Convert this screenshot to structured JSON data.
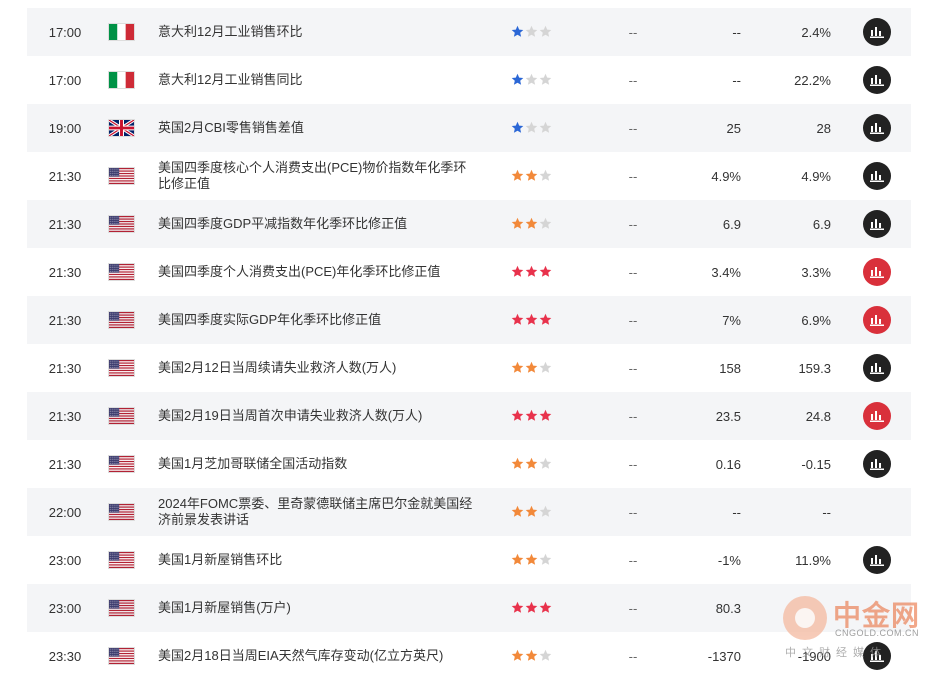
{
  "colors": {
    "star_blue": "#2b67d6",
    "star_orange": "#f2893a",
    "star_red": "#e8324c",
    "star_empty": "#d5d5d5",
    "btn_dark": "#222222",
    "btn_red": "#d9303b"
  },
  "rows": [
    {
      "time": "17:00",
      "flag": "italy",
      "title": "意大利12月工业销售环比",
      "stars": 1,
      "star_color": "blue",
      "prev": "--",
      "forecast": "--",
      "actual": "2.4%",
      "btn": "dark"
    },
    {
      "time": "17:00",
      "flag": "italy",
      "title": "意大利12月工业销售同比",
      "stars": 1,
      "star_color": "blue",
      "prev": "--",
      "forecast": "--",
      "actual": "22.2%",
      "btn": "dark"
    },
    {
      "time": "19:00",
      "flag": "uk",
      "title": "英国2月CBI零售销售差值",
      "stars": 1,
      "star_color": "blue",
      "prev": "--",
      "forecast": "25",
      "actual": "28",
      "btn": "dark"
    },
    {
      "time": "21:30",
      "flag": "us",
      "title": "美国四季度核心个人消费支出(PCE)物价指数年化季环比修正值",
      "stars": 2,
      "star_color": "orange",
      "prev": "--",
      "forecast": "4.9%",
      "actual": "4.9%",
      "btn": "dark"
    },
    {
      "time": "21:30",
      "flag": "us",
      "title": "美国四季度GDP平减指数年化季环比修正值",
      "stars": 2,
      "star_color": "orange",
      "prev": "--",
      "forecast": "6.9",
      "actual": "6.9",
      "btn": "dark"
    },
    {
      "time": "21:30",
      "flag": "us",
      "title": "美国四季度个人消费支出(PCE)年化季环比修正值",
      "stars": 3,
      "star_color": "red",
      "prev": "--",
      "forecast": "3.4%",
      "actual": "3.3%",
      "btn": "red"
    },
    {
      "time": "21:30",
      "flag": "us",
      "title": "美国四季度实际GDP年化季环比修正值",
      "stars": 3,
      "star_color": "red",
      "prev": "--",
      "forecast": "7%",
      "actual": "6.9%",
      "btn": "red"
    },
    {
      "time": "21:30",
      "flag": "us",
      "title": "美国2月12日当周续请失业救济人数(万人)",
      "stars": 2,
      "star_color": "orange",
      "prev": "--",
      "forecast": "158",
      "actual": "159.3",
      "btn": "dark"
    },
    {
      "time": "21:30",
      "flag": "us",
      "title": "美国2月19日当周首次申请失业救济人数(万人)",
      "stars": 3,
      "star_color": "red",
      "prev": "--",
      "forecast": "23.5",
      "actual": "24.8",
      "btn": "red"
    },
    {
      "time": "21:30",
      "flag": "us",
      "title": "美国1月芝加哥联储全国活动指数",
      "stars": 2,
      "star_color": "orange",
      "prev": "--",
      "forecast": "0.16",
      "actual": "-0.15",
      "btn": "dark"
    },
    {
      "time": "22:00",
      "flag": "us",
      "title": "2024年FOMC票委、里奇蒙德联储主席巴尔金就美国经济前景发表讲话",
      "stars": 2,
      "star_color": "orange",
      "prev": "--",
      "forecast": "--",
      "actual": "--",
      "btn": "none"
    },
    {
      "time": "23:00",
      "flag": "us",
      "title": "美国1月新屋销售环比",
      "stars": 2,
      "star_color": "orange",
      "prev": "--",
      "forecast": "-1%",
      "actual": "11.9%",
      "btn": "dark"
    },
    {
      "time": "23:00",
      "flag": "us",
      "title": "美国1月新屋销售(万户)",
      "stars": 3,
      "star_color": "red",
      "prev": "--",
      "forecast": "80.3",
      "actual": "",
      "btn": "none"
    },
    {
      "time": "23:30",
      "flag": "us",
      "title": "美国2月18日当周EIA天然气库存变动(亿立方英尺)",
      "stars": 2,
      "star_color": "orange",
      "prev": "--",
      "forecast": "-1370",
      "actual": "-1900",
      "btn": "dark"
    }
  ],
  "watermark": {
    "brand": "中金网",
    "domain": "CNGOLD.COM.CN",
    "slogan": "中文财经媒体"
  }
}
